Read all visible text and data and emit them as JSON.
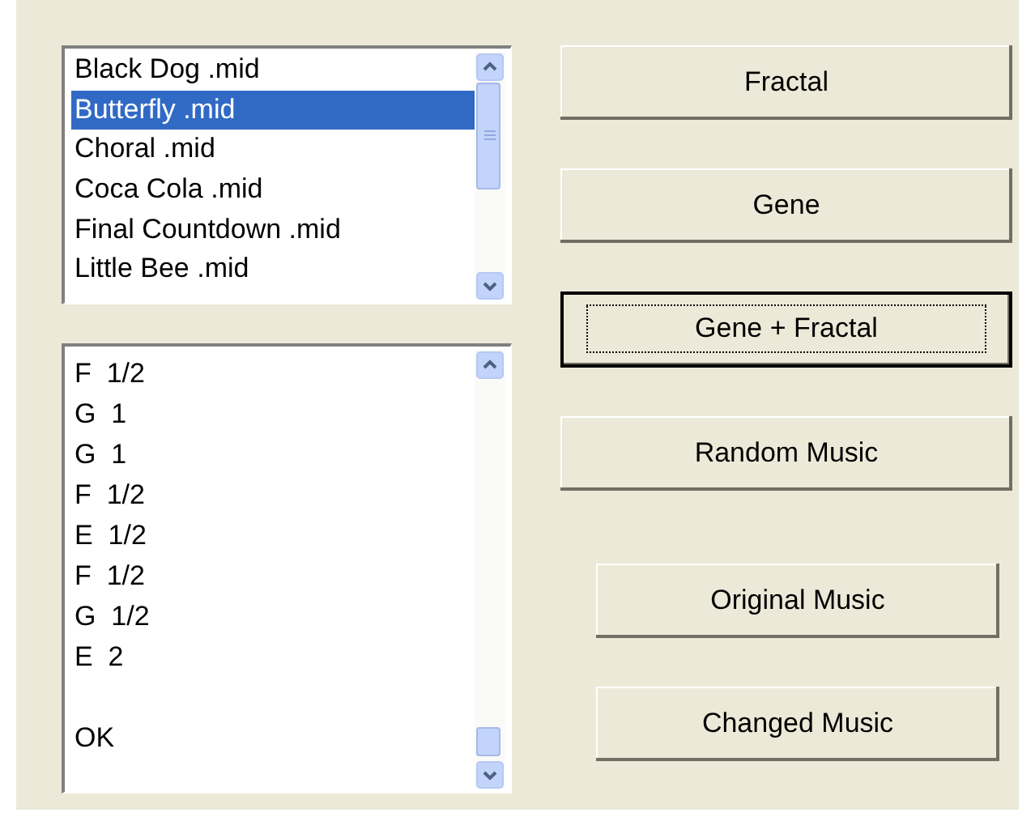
{
  "song_list": {
    "items": [
      {
        "label": "Black Dog .mid",
        "selected": false
      },
      {
        "label": "Butterfly .mid",
        "selected": true
      },
      {
        "label": "Choral .mid",
        "selected": false
      },
      {
        "label": "Coca Cola .mid",
        "selected": false
      },
      {
        "label": "Final Countdown .mid",
        "selected": false
      },
      {
        "label": "Little Bee .mid",
        "selected": false
      }
    ]
  },
  "notes_output": {
    "lines": [
      "F  1/2",
      "G  1",
      "G  1",
      "F  1/2",
      "E  1/2",
      "F  1/2",
      "G  1/2",
      "E  2"
    ],
    "result": "OK"
  },
  "buttons": [
    {
      "label": "Fractal",
      "focused": false,
      "kind": "wide"
    },
    {
      "label": "Gene",
      "focused": false,
      "kind": "wide"
    },
    {
      "label": "Gene + Fractal",
      "focused": true,
      "kind": "wide"
    },
    {
      "label": "Random Music",
      "focused": false,
      "kind": "wide"
    },
    {
      "label": "Original Music",
      "focused": false,
      "kind": "narrow"
    },
    {
      "label": "Changed Music",
      "focused": false,
      "kind": "narrow"
    }
  ]
}
